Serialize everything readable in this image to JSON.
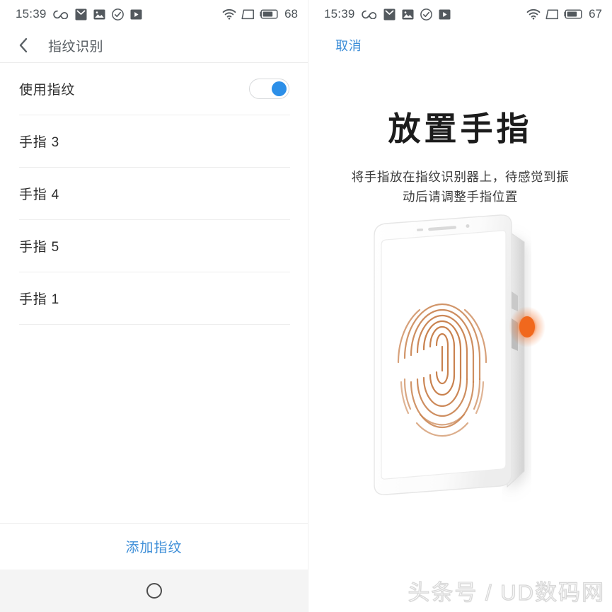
{
  "left_screen": {
    "status_bar": {
      "time": "15:39",
      "icons": [
        "infinity-icon",
        "mail-icon",
        "photo-icon",
        "check-circle-icon",
        "play-icon"
      ],
      "right_icons": [
        "wifi-icon",
        "signal-icon",
        "battery-icon"
      ],
      "battery_level": "68"
    },
    "header": {
      "back_icon": "back-chevron-icon",
      "title": "指纹识别"
    },
    "settings": {
      "toggle_row": {
        "label": "使用指纹",
        "toggle_state": "on"
      },
      "fingerprints": [
        {
          "label": "手指 3"
        },
        {
          "label": "手指 4"
        },
        {
          "label": "手指 5"
        },
        {
          "label": "手指 1"
        }
      ]
    },
    "footer": {
      "add_label": "添加指纹",
      "nav_home_icon": "home-circle-icon"
    }
  },
  "right_screen": {
    "status_bar": {
      "time": "15:39",
      "icons": [
        "infinity-icon",
        "mail-icon",
        "photo-icon",
        "check-circle-icon",
        "play-icon"
      ],
      "right_icons": [
        "wifi-icon",
        "signal-icon",
        "battery-icon"
      ],
      "battery_level": "67"
    },
    "cancel_label": "取消",
    "title": "放置手指",
    "subtitle": "将手指放在指纹识别器上，待感觉到振动后请调整手指位置",
    "illustration": {
      "name": "phone-fingerprint-illustration",
      "fingerprint_icon": "fingerprint-icon",
      "sensor_icon": "fingerprint-sensor-dot"
    }
  },
  "watermark": "头条号 / UD数码网",
  "colors": {
    "accent_blue": "#3f8fd8",
    "toggle_blue": "#2c8fe8",
    "fingerprint_orange": "#c9824f",
    "sensor_orange": "#f1681d",
    "text_primary": "#2b2b2b",
    "text_secondary": "#555b60",
    "navbar_gray": "#f4f4f4",
    "divider": "#ededed"
  }
}
